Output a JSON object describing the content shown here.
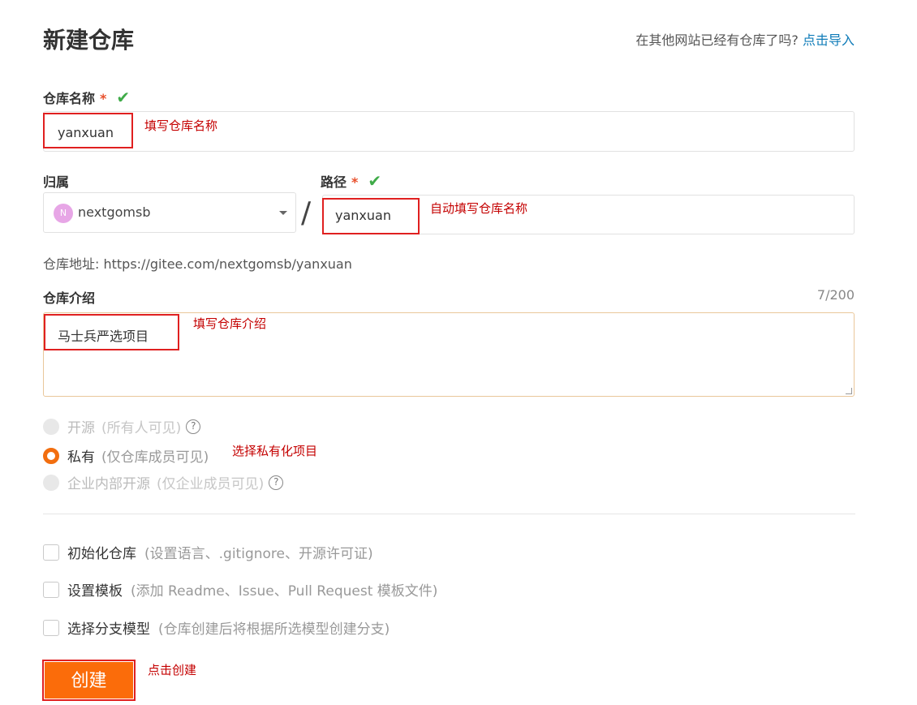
{
  "header": {
    "title": "新建仓库",
    "import_prompt": "在其他网站已经有仓库了吗?",
    "import_link": "点击导入"
  },
  "repo_name": {
    "label": "仓库名称",
    "required_mark": "*",
    "value": "yanxuan",
    "annotation": "填写仓库名称"
  },
  "owner": {
    "label": "归属",
    "avatar_letter": "N",
    "value": "nextgomsb"
  },
  "path": {
    "label": "路径",
    "required_mark": "*",
    "separator": "/",
    "value": "yanxuan",
    "annotation": "自动填写仓库名称"
  },
  "repo_address": "仓库地址: https://gitee.com/nextgomsb/yanxuan",
  "description": {
    "label": "仓库介绍",
    "counter": "7/200",
    "value": "马士兵严选项目",
    "annotation": "填写仓库介绍"
  },
  "visibility": {
    "options": [
      {
        "label": "开源",
        "sub": "(所有人可见)",
        "state": "disabled"
      },
      {
        "label": "私有",
        "sub": "(仅仓库成员可见)",
        "state": "checked"
      },
      {
        "label": "企业内部开源",
        "sub": "(仅企业成员可见)",
        "state": "disabled"
      }
    ],
    "annotation": "选择私有化项目",
    "help_icon": "?"
  },
  "options": [
    {
      "label": "初始化仓库",
      "sub": "(设置语言、.gitignore、开源许可证)"
    },
    {
      "label": "设置模板",
      "sub": "(添加 Readme、Issue、Pull Request 模板文件)"
    },
    {
      "label": "选择分支模型",
      "sub": "(仓库创建后将根据所选模型创建分支)"
    }
  ],
  "submit": {
    "label": "创建",
    "annotation": "点击创建"
  },
  "colors": {
    "accent": "#fb6c0a",
    "annotation_red": "#e02020",
    "check_green": "#3fab48",
    "link": "#0e7bb8"
  }
}
